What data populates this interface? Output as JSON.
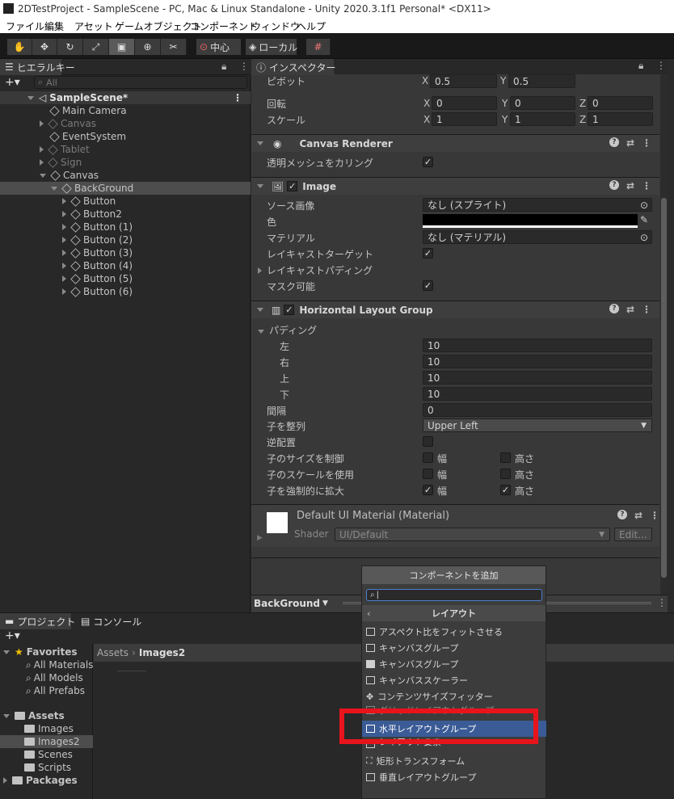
{
  "title_bar": {
    "text": "2DTestProject - SampleScene - PC, Mac & Linux Standalone - Unity 2020.3.1f1 Personal* <DX11>"
  },
  "menu": [
    "ファイル",
    "編集",
    "アセット",
    "ゲームオブジェクト",
    "コンポーネント",
    "ウィンドウ",
    "ヘルプ"
  ],
  "toolbar": {
    "pivot_center": "中心",
    "pivot_local": "ローカル"
  },
  "hierarchy": {
    "tab_label": "ヒエラルキー",
    "search_placeholder": "All",
    "items": [
      {
        "label": "SampleScene*"
      },
      {
        "label": "Main Camera"
      },
      {
        "label": "Canvas"
      },
      {
        "label": "EventSystem"
      },
      {
        "label": "Tablet"
      },
      {
        "label": "Sign"
      },
      {
        "label": "Canvas"
      },
      {
        "label": "BackGround"
      },
      {
        "label": "Button"
      },
      {
        "label": "Button2"
      },
      {
        "label": "Button (1)"
      },
      {
        "label": "Button (2)"
      },
      {
        "label": "Button (3)"
      },
      {
        "label": "Button (4)"
      },
      {
        "label": "Button (5)"
      },
      {
        "label": "Button (6)"
      }
    ]
  },
  "inspector": {
    "tab_label": "インスペクター",
    "transform": {
      "pivot_label": "ピボット",
      "pivot_x": "0.5",
      "pivot_y": "0.5",
      "rotation_label": "回転",
      "rot_x": "0",
      "rot_y": "0",
      "rot_z": "0",
      "scale_label": "スケール",
      "scale_x": "1",
      "scale_y": "1",
      "scale_z": "1",
      "x": "X",
      "y": "Y",
      "z": "Z"
    },
    "canvas_renderer": {
      "title": "Canvas Renderer",
      "cull_label": "透明メッシュをカリング"
    },
    "image": {
      "title": "Image",
      "source_label": "ソース画像",
      "source_value": "なし (スプライト)",
      "color_label": "色",
      "color_value": "#000000",
      "material_label": "マテリアル",
      "material_value": "なし (マテリアル)",
      "raycast_target_label": "レイキャストターゲット",
      "raycast_padding_label": "レイキャストパディング",
      "maskable_label": "マスク可能"
    },
    "hlg": {
      "title": "Horizontal Layout Group",
      "padding_label": "パディング",
      "left_label": "左",
      "left_value": "10",
      "right_label": "右",
      "right_value": "10",
      "top_label": "上",
      "top_value": "10",
      "bottom_label": "下",
      "bottom_value": "10",
      "spacing_label": "間隔",
      "spacing_value": "0",
      "align_label": "子を整列",
      "align_value": "Upper Left",
      "reverse_label": "逆配置",
      "control_size_label": "子のサイズを制御",
      "use_scale_label": "子のスケールを使用",
      "force_expand_label": "子を強制的に拡大",
      "width": "幅",
      "height": "高さ"
    },
    "material": {
      "title": "Default UI Material (Material)",
      "shader_label": "Shader",
      "shader_value": "UI/Default",
      "edit": "Edit..."
    },
    "footer_object": "BackGround"
  },
  "project": {
    "tab_project": "プロジェクト",
    "tab_console": "コンソール",
    "breadcrumb_root": "Assets",
    "breadcrumb_current": "Images2",
    "tree": {
      "favorites": "Favorites",
      "all_materials": "All Materials",
      "all_models": "All Models",
      "all_prefabs": "All Prefabs",
      "assets": "Assets",
      "images": "Images",
      "images2": "Images2",
      "scenes": "Scenes",
      "scripts": "Scripts",
      "packages": "Packages"
    }
  },
  "add_component": {
    "button": "コンポーネントを追加",
    "category": "レイアウト",
    "items": [
      {
        "label": "アスペクト比をフィットさせる"
      },
      {
        "label": "キャンバスグループ"
      },
      {
        "label": "キャンバスグループ"
      },
      {
        "label": "キャンバススケーラー"
      },
      {
        "label": "コンテンツサイズフィッター"
      },
      {
        "label": "グリッドレイアウトグループ"
      },
      {
        "label": "水平レイアウトグループ"
      },
      {
        "label": "レイアウト要素"
      },
      {
        "label": "矩形トランスフォーム"
      },
      {
        "label": "垂直レイアウトグループ"
      }
    ],
    "highlight_color": "#e8141c"
  }
}
